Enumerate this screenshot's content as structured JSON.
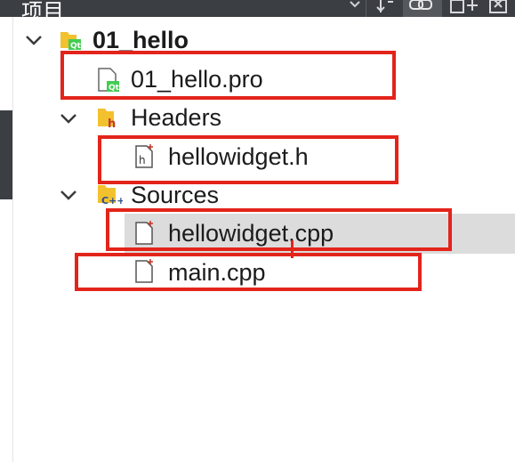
{
  "panel": {
    "title": "项目"
  },
  "tree": {
    "project": {
      "label": "01_hello"
    },
    "pro_file": {
      "label": "01_hello.pro"
    },
    "headers_folder": {
      "label": "Headers"
    },
    "header_file": {
      "label": "hellowidget.h"
    },
    "sources_folder": {
      "label": "Sources"
    },
    "source_file_1": {
      "label": "hellowidget.cpp"
    },
    "source_file_2": {
      "label": "main.cpp"
    }
  },
  "colors": {
    "toolbar_bg": "#3b3e42",
    "selection_bg": "#dcdcdc",
    "annotation": "#e3241b",
    "folder": "#f2c12e",
    "qt_green": "#41cd52"
  },
  "icons": [
    "filter-icon",
    "link-icon",
    "split-add-icon",
    "close-pane-icon",
    "folder-icon",
    "qt-project-icon",
    "header-file-icon",
    "cpp-file-icon"
  ]
}
